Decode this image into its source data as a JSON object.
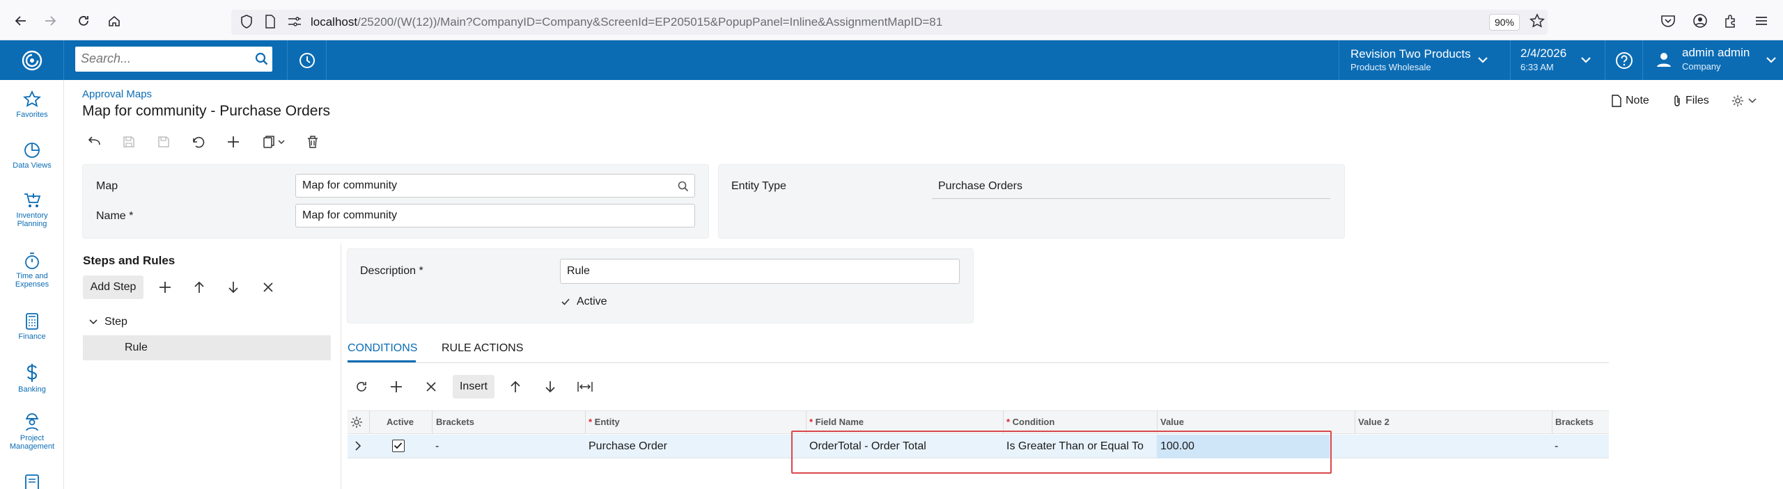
{
  "browser": {
    "url_host": "localhost",
    "url_path": "/25200/(W(12))/Main?CompanyID=Company&ScreenId=EP205015&PopupPanel=Inline&AssignmentMapID=81",
    "zoom": "90%"
  },
  "header": {
    "search_placeholder": "Search...",
    "branch_name": "Revision Two Products",
    "branch_sub": "Products Wholesale",
    "date": "2/4/2026",
    "time": "6:33 AM",
    "user_name": "admin admin",
    "user_company": "Company"
  },
  "left_nav": {
    "items": [
      {
        "label": "Favorites",
        "icon": "star-icon"
      },
      {
        "label": "Data Views",
        "icon": "pie-chart-icon"
      },
      {
        "label": "Inventory Planning",
        "icon": "cart-icon"
      },
      {
        "label": "Time and Expenses",
        "icon": "stopwatch-icon"
      },
      {
        "label": "Finance",
        "icon": "calculator-icon"
      },
      {
        "label": "Banking",
        "icon": "dollar-icon"
      },
      {
        "label": "Project Management",
        "icon": "worker-icon"
      }
    ]
  },
  "page": {
    "breadcrumb": "Approval Maps",
    "title": "Map for community - Purchase Orders",
    "note_label": "Note",
    "files_label": "Files"
  },
  "summary": {
    "map_label": "Map",
    "map_value": "Map for community",
    "name_label": "Name",
    "name_value": "Map for community",
    "entity_type_label": "Entity Type",
    "entity_type_value": "Purchase Orders"
  },
  "steps": {
    "title": "Steps and Rules",
    "add_step_label": "Add Step",
    "tree": [
      {
        "label": "Step"
      },
      {
        "label": "Rule"
      }
    ]
  },
  "rule": {
    "description_label": "Description",
    "description_value": "Rule",
    "active_label": "Active"
  },
  "tabs": [
    {
      "label": "CONDITIONS"
    },
    {
      "label": "RULE ACTIONS"
    }
  ],
  "conditions_toolbar": {
    "insert_label": "Insert"
  },
  "grid": {
    "columns": [
      "Active",
      "Brackets",
      "Entity",
      "Field Name",
      "Condition",
      "Value",
      "Value 2",
      "Brackets"
    ],
    "rows": [
      {
        "active": true,
        "brackets": "-",
        "entity": "Purchase Order",
        "field_name": "OrderTotal - Order Total",
        "condition": "Is Greater Than or Equal To",
        "value": "100.00",
        "value2": "",
        "brackets_close": "-"
      }
    ]
  },
  "colors": {
    "brand_blue": "#0b6cb4",
    "highlight_red": "#d9474c",
    "selected_row": "#e8f3fc"
  }
}
